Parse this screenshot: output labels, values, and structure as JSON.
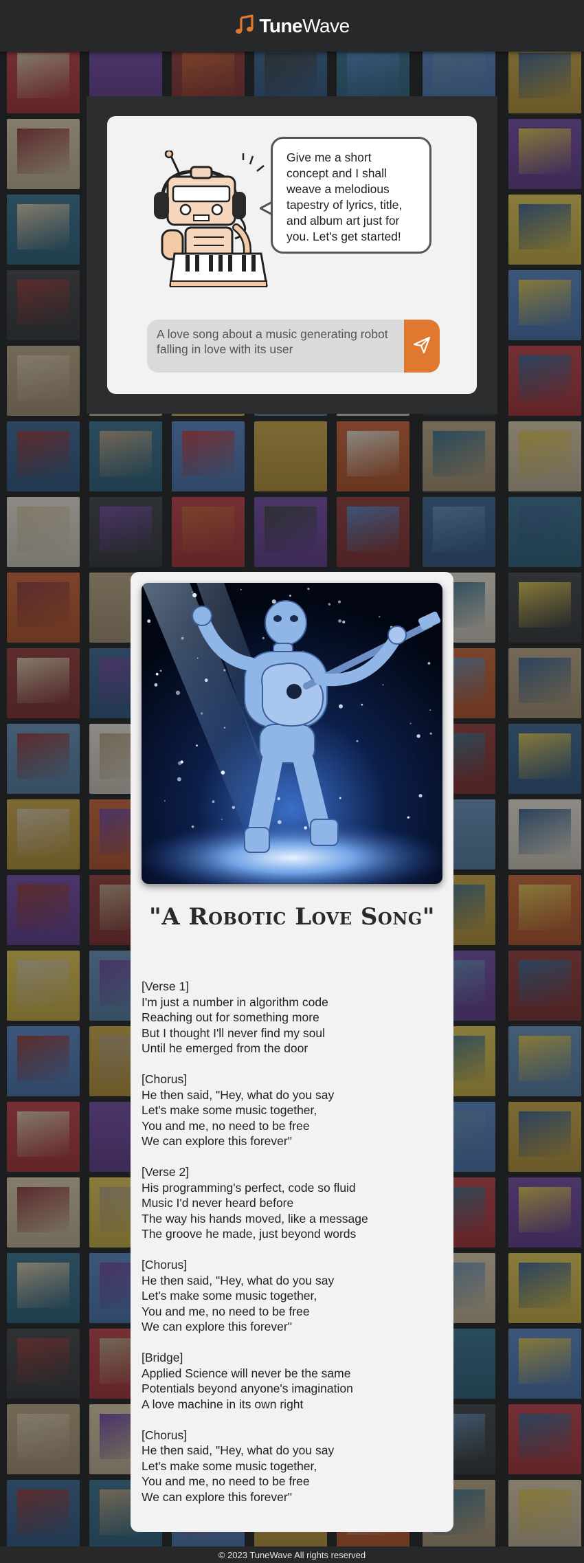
{
  "header": {
    "brand_tune": "Tune",
    "brand_wave": "Wave",
    "logo_icon": "music-note-icon",
    "accent": "#e07830"
  },
  "generator": {
    "bubble_text": "Give me a short concept and I shall weave a melodious tapestry of lyrics, title, and album art just for you. Let's get started!",
    "prompt_value": "A love song about a music generating robot falling in love with its user",
    "send_icon": "send-icon"
  },
  "song": {
    "title": "\"A Robotic Love Song\"",
    "stanzas": [
      {
        "lines": [
          "[Verse 1]",
          "I'm just a number in algorithm code",
          "Reaching out for something more",
          "But I thought I'll never find my soul",
          "Until he emerged from the door"
        ]
      },
      {
        "lines": [
          "[Chorus]",
          "He then said, \"Hey, what do you say",
          "Let's make some music together,",
          "You and me, no need to be free",
          "We can explore this forever\""
        ]
      },
      {
        "lines": [
          "[Verse 2]",
          "His programming's perfect, code so fluid",
          "Music I'd never heard before",
          "The way his hands moved, like a message",
          "The groove he made, just beyond words"
        ]
      },
      {
        "lines": [
          "[Chorus]",
          "He then said, \"Hey, what do you say",
          "Let's make some music together,",
          "You and me, no need to be free",
          "We can explore this forever\""
        ]
      },
      {
        "lines": [
          "[Bridge]",
          "Applied Science will never be the same",
          "Potentials beyond anyone's imagination",
          "A love machine in its own right"
        ]
      },
      {
        "lines": [
          "[Chorus]",
          "He then said, \"Hey, what do you say",
          "Let's make some music together,",
          "You and me, no need to be free",
          "We can explore this forever\""
        ]
      }
    ]
  },
  "footer": {
    "text": "© 2023 TuneWave All rights reserved"
  }
}
